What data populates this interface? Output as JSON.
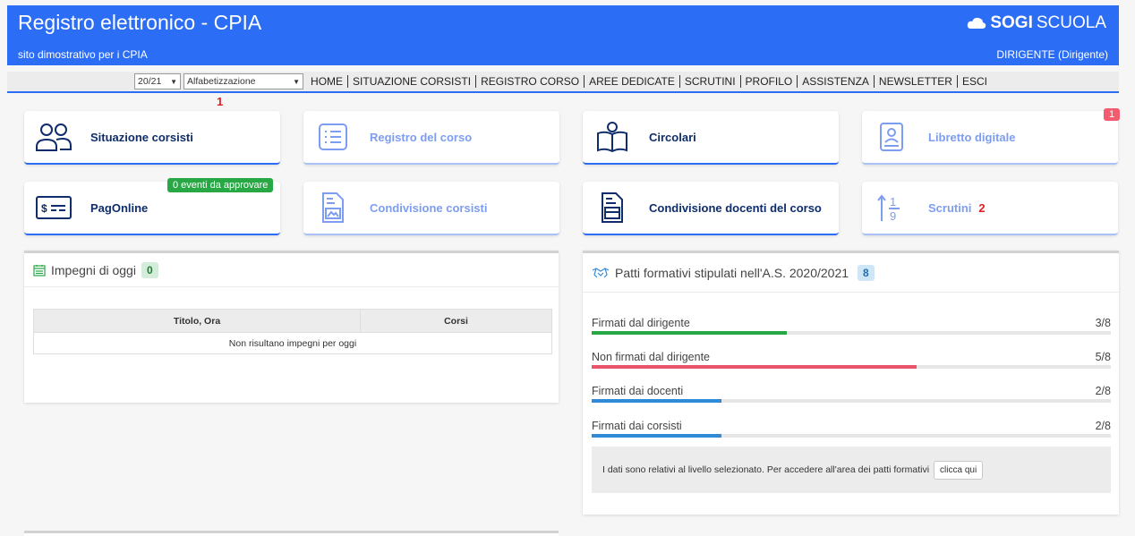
{
  "header": {
    "title": "Registro elettronico - CPIA",
    "subtitle": "sito dimostrativo per i CPIA",
    "logo_bold": "SOGI",
    "logo_light": "SCUOLA",
    "user": "DIRIGENTE (Dirigente)"
  },
  "nav": {
    "year_select": "20/21",
    "level_select": "Alfabetizzazione",
    "links": [
      "HOME",
      "SITUAZIONE CORSISTI",
      "REGISTRO CORSO",
      "AREE DEDICATE",
      "SCRUTINI",
      "PROFILO",
      "ASSISTENZA",
      "NEWSLETTER",
      "ESCI"
    ]
  },
  "tiles": {
    "situazione": {
      "label": "Situazione corsisti",
      "note": "1",
      "icon": "users-icon"
    },
    "registro": {
      "label": "Registro del corso",
      "icon": "list-icon"
    },
    "circolari": {
      "label": "Circolari",
      "icon": "reading-person-icon"
    },
    "libretto": {
      "label": "Libretto digitale",
      "badge": "1",
      "icon": "contact-book-icon"
    },
    "pagonline": {
      "label": "PagOnline",
      "badge": "0 eventi da approvare",
      "icon": "payment-card-icon"
    },
    "cond_corsisti": {
      "label": "Condivisione corsisti",
      "icon": "shared-document-icon"
    },
    "cond_docenti": {
      "label": "Condivisione docenti del corso",
      "icon": "folder-document-icon"
    },
    "scrutini": {
      "label": "Scrutini",
      "count": "2",
      "icon": "fraction-icon"
    }
  },
  "impegni": {
    "title": "Impegni di oggi",
    "count": "0",
    "columns": [
      "Titolo, Ora",
      "Corsi"
    ],
    "empty": "Non risultano impegni per oggi"
  },
  "patti": {
    "title": "Patti formativi stipulati nell'A.S. 2020/2021",
    "count": "8",
    "stats": [
      {
        "label": "Firmati dal dirigente",
        "value": "3/8",
        "fraction": 0.375,
        "color": "#28a745"
      },
      {
        "label": "Non firmati dal dirigente",
        "value": "5/8",
        "fraction": 0.625,
        "color": "#e9546b"
      },
      {
        "label": "Firmati dai docenti",
        "value": "2/8",
        "fraction": 0.25,
        "color": "#2f8bd8"
      },
      {
        "label": "Firmati dai corsisti",
        "value": "2/8",
        "fraction": 0.25,
        "color": "#2f8bd8"
      }
    ],
    "info": "I dati sono relativi al livello selezionato. Per accedere all'area dei patti formativi",
    "button": "clicca qui"
  },
  "colors": {
    "primary": "#2c6df6",
    "dark_label": "#0f2d6b",
    "dim_label": "#7d9df0"
  }
}
